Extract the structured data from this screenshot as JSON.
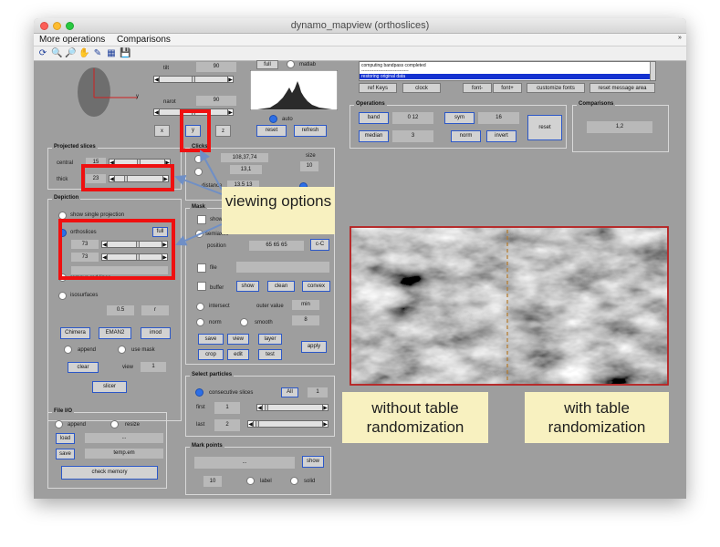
{
  "window": {
    "title": "dynamo_mapview (orthoslices)"
  },
  "menu": {
    "items": [
      "More operations",
      "Comparisons"
    ]
  },
  "orientation": {
    "tilt_label": "tilt",
    "tilt_value": "90",
    "narot_label": "narot",
    "narot_value": "90",
    "axis_y": "y"
  },
  "axis_buttons": [
    "x",
    "y",
    "z"
  ],
  "histogram": {
    "full_label": "full",
    "matlab_label": "matlab",
    "auto_label": "auto",
    "reset_label": "reset",
    "refresh_label": "refresh"
  },
  "messages": {
    "lines": [
      "computing bandpass completed",
      "-------------------------------",
      "restoring original data"
    ]
  },
  "msg_buttons": [
    "ref Keys",
    "clock",
    "font-",
    "font+",
    "customize fonts",
    "reset message area"
  ],
  "operations": {
    "title": "Operations",
    "band_label": "band",
    "band_value": "0 12",
    "sym_label": "sym",
    "sym_value": "16",
    "median_label": "median",
    "median_value": "3",
    "norm_label": "norm",
    "invert_label": "invert",
    "reset_label": "reset"
  },
  "comparisons": {
    "title": "Comparisons",
    "value": "1,2"
  },
  "projected": {
    "title": "Projected slices",
    "central_label": "central",
    "central_value": "15",
    "thick_label": "thick",
    "thick_value": "23"
  },
  "clicks": {
    "title": "Clicks",
    "coords": "108,37,74",
    "value2": "13,1",
    "size_label": "size",
    "size_value": "10",
    "distance_label": "distance",
    "distance_value": "13.5 13"
  },
  "depiction": {
    "title": "Depiction",
    "single_label": "show single projection",
    "ortho_label": "orthoslices",
    "full_label": "full",
    "v1": "73",
    "v2": "73",
    "overlay_label": "remove red lines",
    "iso_label": "isosurfaces",
    "iso_value": "0.5",
    "r_label": "r",
    "chimera": "Chimera",
    "emanv2": "EMAN2",
    "imod": "imod",
    "append_label": "append",
    "mask_label": "use mask",
    "clear_label": "clear",
    "view_label": "view",
    "view_value": "1",
    "slicer_label": "slicer"
  },
  "mask": {
    "title": "Mask",
    "show_label": "show",
    "semiaxes_label": "semiaxes",
    "position_label": "position",
    "position_value": "65 65 65",
    "cc_label": "c-C",
    "file_label": "file",
    "buffer_label": "buffer",
    "show_btn": "show",
    "clean_btn": "clean",
    "convex_btn": "convex",
    "intersect_label": "intersect",
    "outer_label": "outer value",
    "outer_value": "min",
    "norm_label": "norm",
    "smooth_label": "smooth",
    "smooth_value": "8",
    "save": "save",
    "view": "view",
    "layer": "layer",
    "crop": "crop",
    "edit": "edit",
    "test": "test",
    "apply": "apply"
  },
  "select": {
    "title": "Select particles",
    "consecutive_label": "consecutive slices",
    "all_label": "All",
    "all_value": "1",
    "first_label": "first",
    "first_value": "1",
    "last_label": "last",
    "last_value": "2"
  },
  "fileio": {
    "title": "File I/O",
    "append_label": "append",
    "resize_label": "resize",
    "load_label": "load",
    "load_value": "...",
    "save_label": "save",
    "save_value": "temp.em",
    "check_label": "check memory"
  },
  "markpoints": {
    "title": "Mark points",
    "value": "...",
    "show_label": "show",
    "v10": "10",
    "label_label": "label",
    "solid_label": "solid"
  },
  "annotations": {
    "viewing": "viewing options",
    "without": "without table randomization",
    "with": "with table randomization"
  },
  "colors": {
    "window_bg": "#9e9e9e",
    "highlight": "#ef1010",
    "note_bg": "#f8f1c0",
    "accent_blue": "#2d6fe6"
  }
}
